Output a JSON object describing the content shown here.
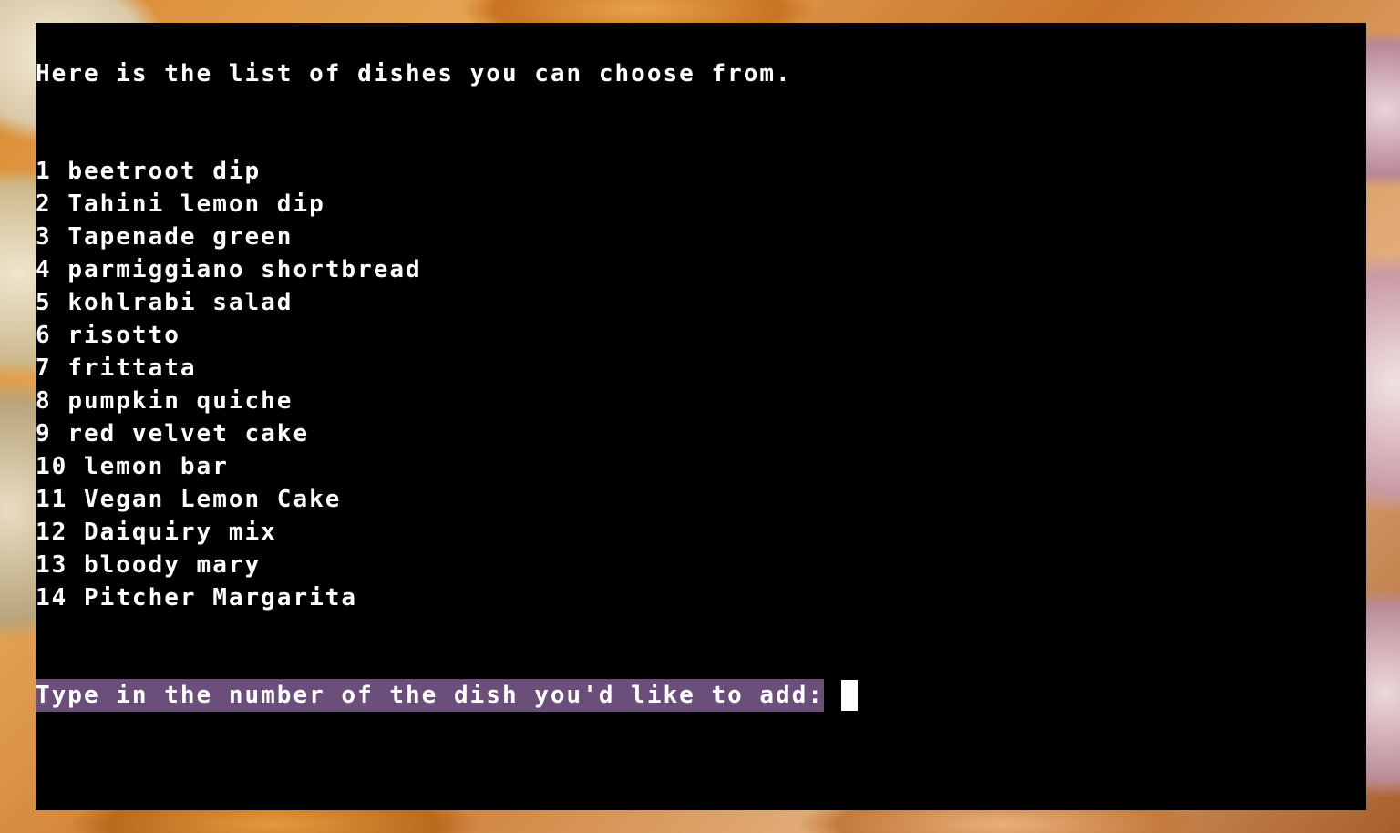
{
  "terminal": {
    "intro": "Here is the list of dishes you can choose from.",
    "dishes": [
      {
        "number": "1",
        "name": "beetroot dip"
      },
      {
        "number": "2",
        "name": "Tahini lemon dip"
      },
      {
        "number": "3",
        "name": "Tapenade green"
      },
      {
        "number": "4",
        "name": "parmiggiano shortbread"
      },
      {
        "number": "5",
        "name": "kohlrabi salad"
      },
      {
        "number": "6",
        "name": "risotto"
      },
      {
        "number": "7",
        "name": "frittata"
      },
      {
        "number": "8",
        "name": "pumpkin quiche"
      },
      {
        "number": "9",
        "name": "red velvet cake"
      },
      {
        "number": "10",
        "name": "lemon bar"
      },
      {
        "number": "11",
        "name": "Vegan Lemon Cake"
      },
      {
        "number": "12",
        "name": "Daiquiry mix"
      },
      {
        "number": "13",
        "name": "bloody mary"
      },
      {
        "number": "14",
        "name": "Pitcher Margarita"
      }
    ],
    "prompt": "Type in the number of the dish you'd like to add:",
    "input_value": ""
  },
  "colors": {
    "terminal_bg": "#000000",
    "text": "#ffffff",
    "prompt_highlight": "#6b4f7a"
  }
}
